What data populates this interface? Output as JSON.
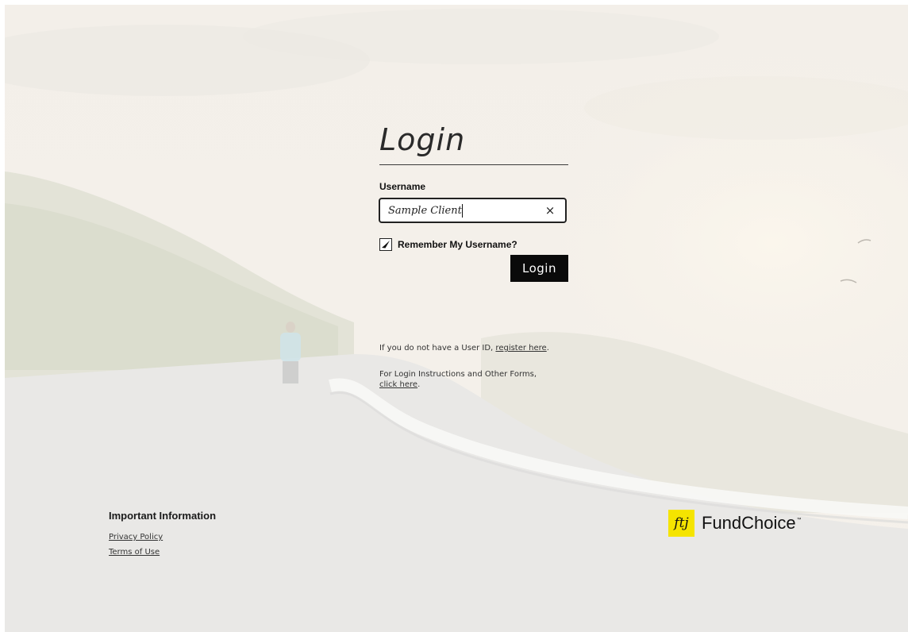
{
  "login": {
    "title": "Login",
    "username_label": "Username",
    "username_value": "Sample Client",
    "clear_symbol": "×",
    "remember_label": "Remember My Username?",
    "remember_checked": true,
    "submit_label": "Login"
  },
  "info": {
    "register_prefix": "If you do not have a User ID,",
    "register_link": "register here",
    "register_suffix": ".",
    "instructions_prefix": "For Login Instructions and Other Forms,",
    "instructions_link": "click here",
    "instructions_suffix": "."
  },
  "footer": {
    "important_title": "Important Information",
    "privacy_link": "Privacy Policy",
    "terms_link": "Terms of Use"
  },
  "brand": {
    "mark": "ftj",
    "name": "FundChoice",
    "tm": "™",
    "accent_color": "#f5e400"
  },
  "icons": {
    "clear": "close-icon",
    "check": "checkmark-icon"
  }
}
